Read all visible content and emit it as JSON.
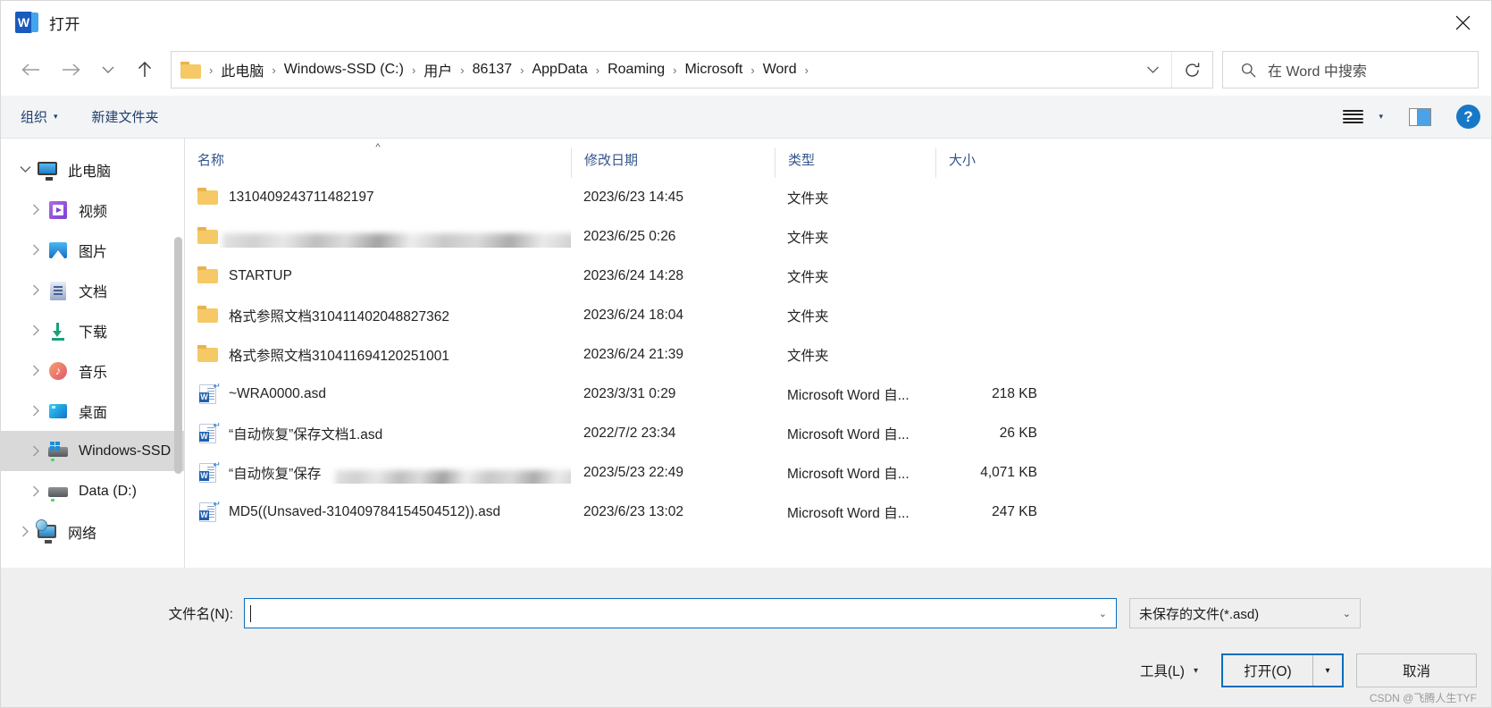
{
  "window": {
    "title": "打开",
    "app_icon": "word-icon",
    "close_label": "✕"
  },
  "nav": {
    "back": "back-arrow",
    "forward": "forward-arrow",
    "recent": "chevron-down",
    "up": "up-arrow"
  },
  "address": {
    "crumbs": [
      "此电脑",
      "Windows-SSD (C:)",
      "用户",
      "86137",
      "AppData",
      "Roaming",
      "Microsoft",
      "Word"
    ],
    "separator": "›",
    "dropdown": "chevron-down-icon",
    "refresh": "refresh-icon"
  },
  "search": {
    "placeholder": "在 Word 中搜索",
    "icon": "search-icon"
  },
  "commandbar": {
    "organize": "组织",
    "new_folder": "新建文件夹",
    "caret": "▾",
    "view_icon": "list-view-icon",
    "pane_icon": "preview-pane-icon",
    "help": "?"
  },
  "sidebar": {
    "items": [
      {
        "label": "此电脑",
        "icon": "pc-icon",
        "level": 1,
        "expander": "chevron-down",
        "selected": false
      },
      {
        "label": "视频",
        "icon": "videos-icon",
        "level": 2,
        "expander": "chevron-right",
        "selected": false
      },
      {
        "label": "图片",
        "icon": "pictures-icon",
        "level": 2,
        "expander": "chevron-right",
        "selected": false
      },
      {
        "label": "文档",
        "icon": "documents-icon",
        "level": 2,
        "expander": "chevron-right",
        "selected": false
      },
      {
        "label": "下载",
        "icon": "downloads-icon",
        "level": 2,
        "expander": "chevron-right",
        "selected": false
      },
      {
        "label": "音乐",
        "icon": "music-icon",
        "level": 2,
        "expander": "chevron-right",
        "selected": false
      },
      {
        "label": "桌面",
        "icon": "desktop-icon",
        "level": 2,
        "expander": "chevron-right",
        "selected": false
      },
      {
        "label": "Windows-SSD",
        "icon": "windows-drive-icon",
        "level": 2,
        "expander": "chevron-right",
        "selected": true
      },
      {
        "label": "Data (D:)",
        "icon": "drive-icon",
        "level": 2,
        "expander": "chevron-right",
        "selected": false
      },
      {
        "label": "网络",
        "icon": "network-icon",
        "level": 1,
        "expander": "chevron-right",
        "selected": false
      }
    ]
  },
  "filelist": {
    "columns": [
      "名称",
      "修改日期",
      "类型",
      "大小"
    ],
    "sort_column": "名称",
    "sort_indicator": "^",
    "rows": [
      {
        "name": "1310409243711482197",
        "icon": "folder-icon",
        "date": "2023/6/23 14:45",
        "type": "文件夹",
        "size": "",
        "redacted": false
      },
      {
        "name": "",
        "icon": "folder-icon",
        "date": "2023/6/25 0:26",
        "type": "文件夹",
        "size": "",
        "redacted": true
      },
      {
        "name": "STARTUP",
        "icon": "folder-icon",
        "date": "2023/6/24 14:28",
        "type": "文件夹",
        "size": "",
        "redacted": false
      },
      {
        "name": "格式参照文档310411402048827362",
        "icon": "folder-icon",
        "date": "2023/6/24 18:04",
        "type": "文件夹",
        "size": "",
        "redacted": false
      },
      {
        "name": "格式参照文档310411694120251001",
        "icon": "folder-icon",
        "date": "2023/6/24 21:39",
        "type": "文件夹",
        "size": "",
        "redacted": false
      },
      {
        "name": "~WRA0000.asd",
        "icon": "word-asd-icon",
        "date": "2023/3/31 0:29",
        "type": "Microsoft Word 自...",
        "size": "218 KB",
        "redacted": false
      },
      {
        "name": "“自动恢复”保存文档1.asd",
        "icon": "word-asd-icon",
        "date": "2022/7/2 23:34",
        "type": "Microsoft Word 自...",
        "size": "26 KB",
        "redacted": false
      },
      {
        "name": "“自动恢复”保存",
        "icon": "word-asd-icon",
        "date": "2023/5/23 22:49",
        "type": "Microsoft Word 自...",
        "size": "4,071 KB",
        "redacted": true
      },
      {
        "name": "MD5((Unsaved-310409784154504512)).asd",
        "icon": "word-asd-icon",
        "date": "2023/6/23 13:02",
        "type": "Microsoft Word 自...",
        "size": "247 KB",
        "redacted": false
      }
    ]
  },
  "footer": {
    "filename_label": "文件名(N):",
    "filename_value": "",
    "filter_value": "未保存的文件(*.asd)",
    "tools_label": "工具(L)",
    "open_label": "打开(O)",
    "cancel_label": "取消",
    "watermark": "CSDN @飞腾人生TYF"
  },
  "colors": {
    "accent": "#0a6ebd",
    "word_blue": "#185ABD",
    "header_text": "#33558c",
    "command_text": "#1f3f6e"
  }
}
